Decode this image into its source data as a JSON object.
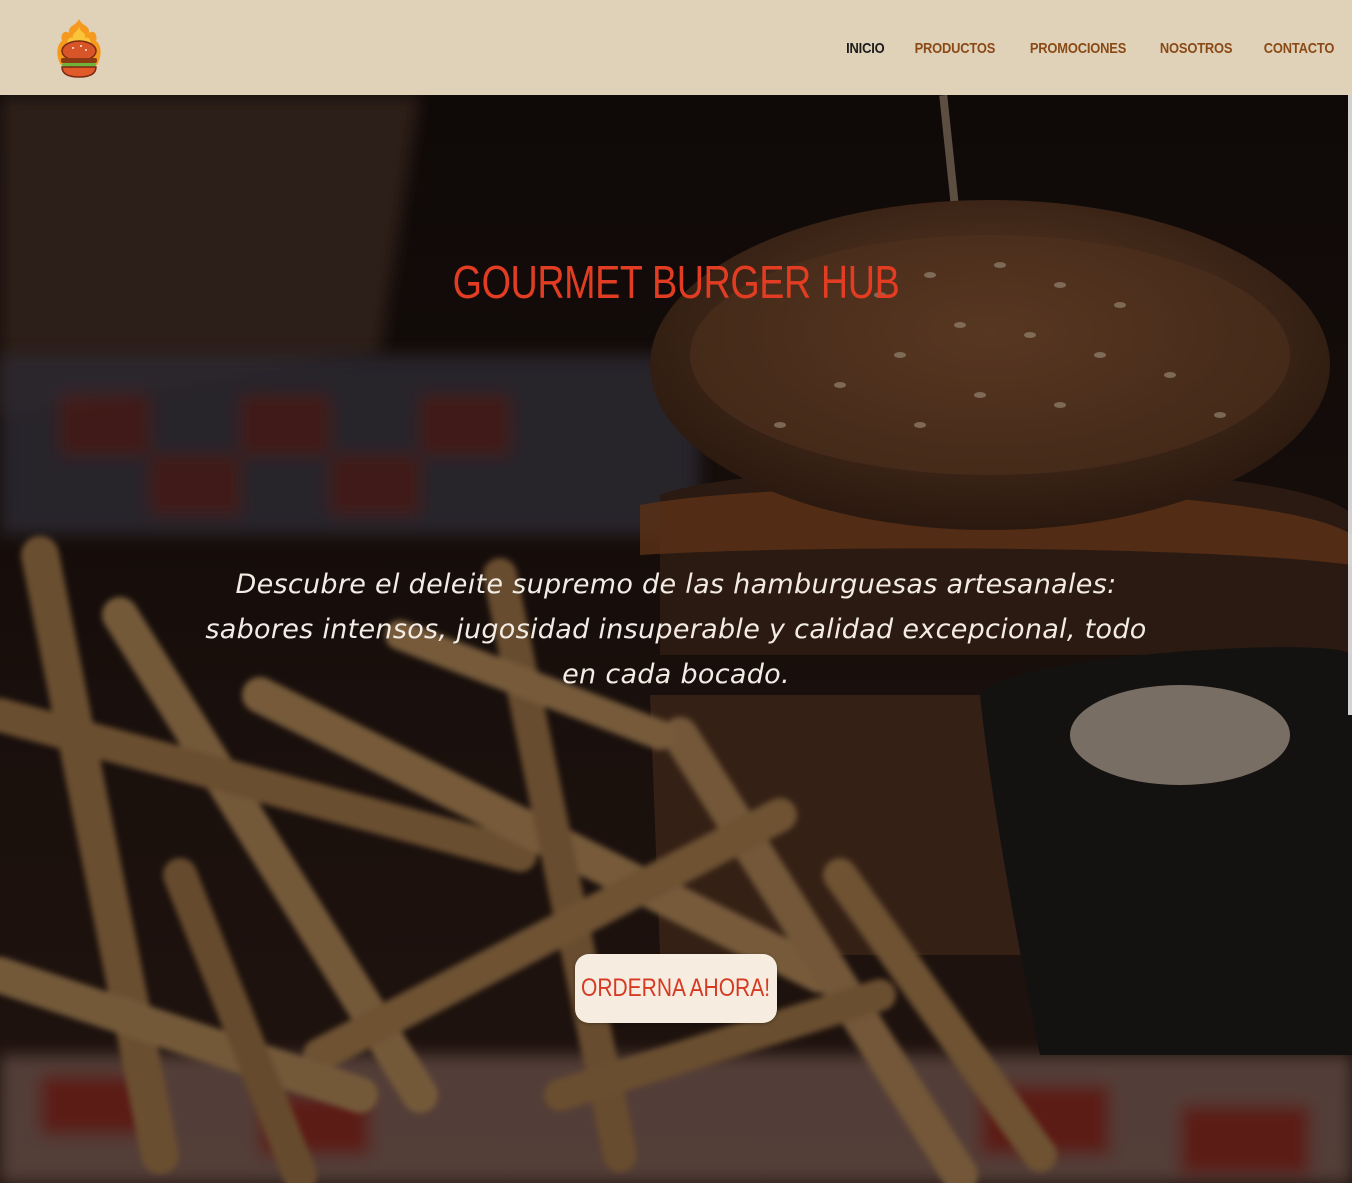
{
  "header": {
    "logo_icon": "flaming-burger-logo",
    "nav": [
      {
        "label": "INICIO",
        "active": true
      },
      {
        "label": "PRODUCTOS",
        "active": false
      },
      {
        "label": "PROMOCIONES",
        "active": false
      },
      {
        "label": "NOSOTROS",
        "active": false
      },
      {
        "label": "CONTACTO",
        "active": false
      }
    ]
  },
  "hero": {
    "title": "GOURMET BURGER HUB",
    "description": "Descubre el deleite supremo de las hamburguesas artesanales: sabores intensos, jugosidad insuperable y calidad excepcional, todo en cada bocado.",
    "cta_label": "ORDERNA AHORA!"
  },
  "colors": {
    "header_bg": "#e0d2b9",
    "nav_link": "#8a4a16",
    "nav_active": "#1c1b1b",
    "title_red": "#e23d23",
    "cta_bg": "#f6ece0",
    "cta_text": "#d73a22"
  }
}
